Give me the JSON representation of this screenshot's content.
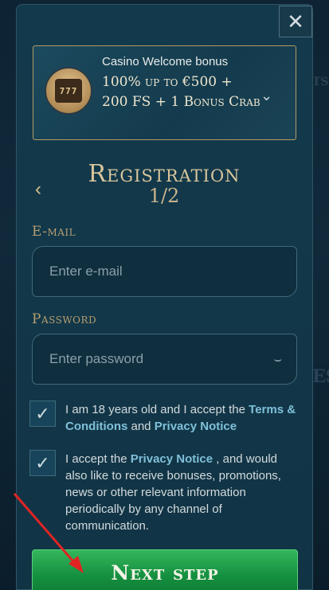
{
  "close_label": "✕",
  "bonus": {
    "small": "Casino Welcome bonus",
    "big": "100% up to €500 + 200 FS + 1 Bonus Crab",
    "icon_text": "777"
  },
  "title": "Registration",
  "step": "1/2",
  "email": {
    "label": "E-mail",
    "placeholder": "Enter e-mail"
  },
  "password": {
    "label": "Password",
    "placeholder": "Enter password"
  },
  "consent1": {
    "text_before": "I am 18 years old and I accept the ",
    "link1": "Terms & Conditions",
    "middle": " and ",
    "link2": "Privacy Notice"
  },
  "consent2": {
    "text_before": "I accept the ",
    "link": "Privacy Notice",
    "text_after": " , and would also like to receive bonuses, promotions, news or other relevant information periodically by any channel of communication."
  },
  "next_button": "Next step",
  "colors": {
    "accent_gold": "#d9c59b",
    "cta_green": "#159040",
    "link_blue": "#7fc0d9",
    "arrow_red": "#e02424"
  },
  "icons": [
    "close-icon",
    "chevron-down-icon",
    "back-arrow-icon",
    "eye-closed-icon",
    "checkmark-icon",
    "slot-machine-icon"
  ]
}
